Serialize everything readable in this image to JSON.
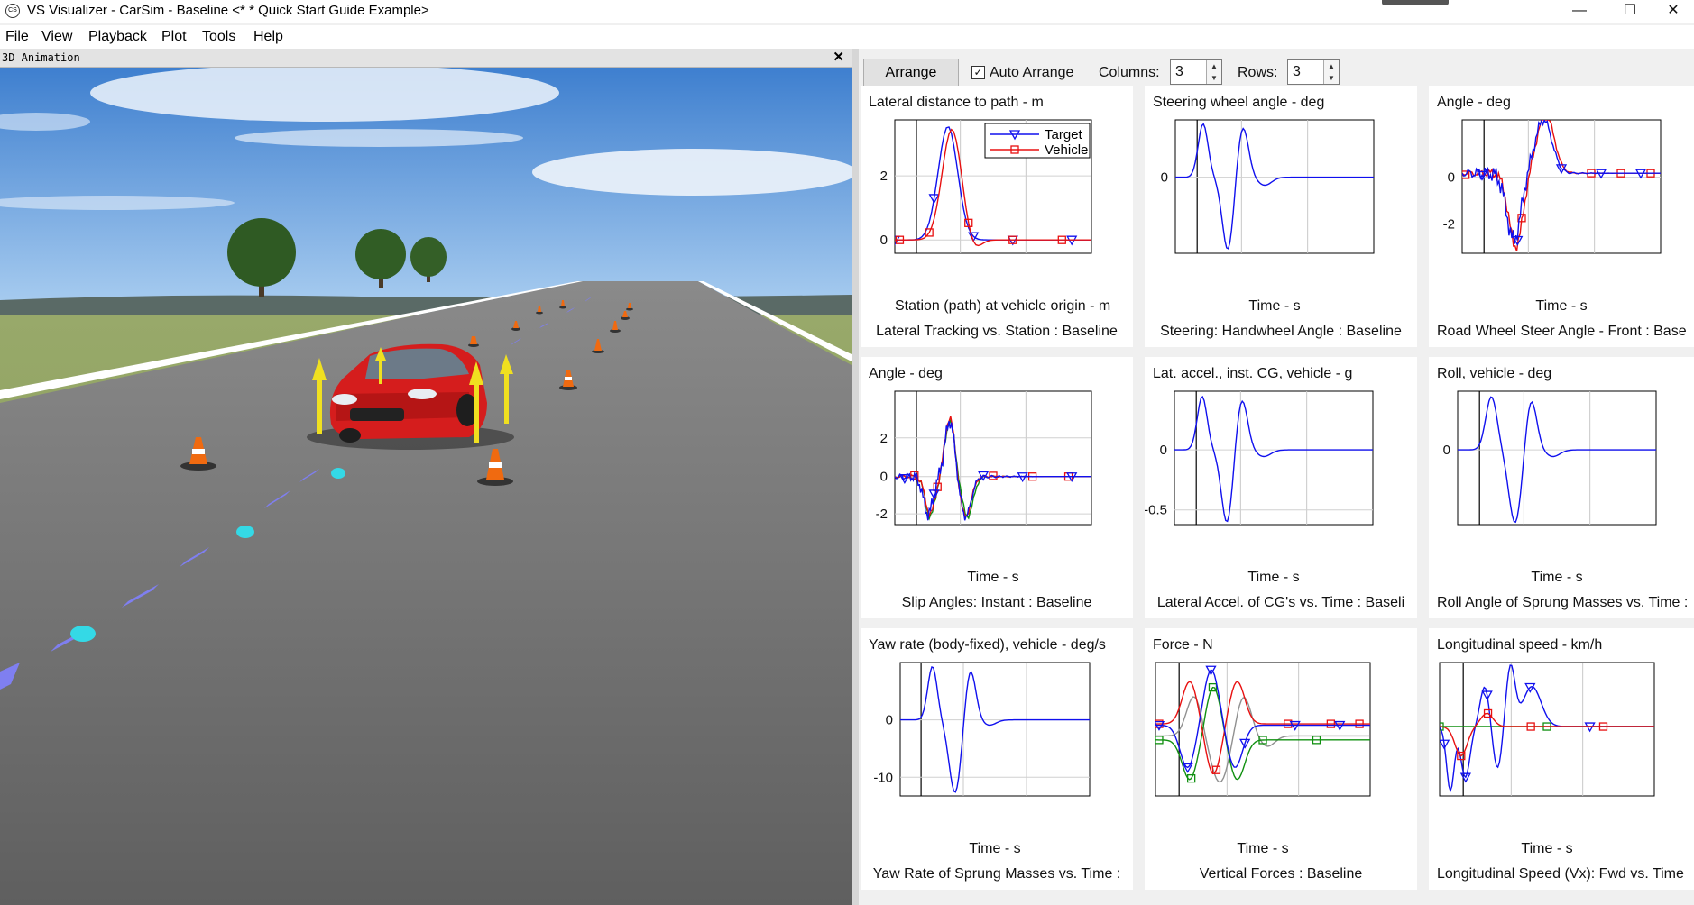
{
  "window": {
    "title": "VS Visualizer - CarSim - Baseline <* * Quick Start Guide Example>",
    "app_icon": "carsim-logo-icon",
    "app_icon_text": "CS",
    "controls": [
      "minimize-icon",
      "maximize-icon",
      "close-icon"
    ]
  },
  "menu": [
    "File",
    "View",
    "Playback",
    "Plot",
    "Tools",
    "Help"
  ],
  "animation": {
    "title": "3D Animation",
    "close_label": "✕",
    "colors": {
      "sky": "#5d9ad8",
      "grass": "#8ea25e",
      "road": "#6c6c6c",
      "car": "#d62020",
      "path_marker": "#7f7ff0"
    }
  },
  "toolbar": {
    "arrange_label": "Arrange",
    "auto_arrange_label": "Auto Arrange",
    "auto_arrange_checked": true,
    "columns_label": "Columns:",
    "columns_value": "3",
    "rows_label": "Rows:",
    "rows_value": "3"
  },
  "plots": [
    {
      "title": "Lateral distance to path - m",
      "xlabel": "Station (path) at vehicle origin - m",
      "caption": "Lateral Tracking vs. Station : Baseline",
      "yticks": [
        "2",
        "0"
      ],
      "legend": [
        "Target",
        "Vehicle"
      ]
    },
    {
      "title": "Steering wheel angle - deg",
      "xlabel": "Time - s",
      "caption": "Steering: Handwheel Angle : Baseline",
      "yticks": [
        "0"
      ]
    },
    {
      "title": "Angle - deg",
      "xlabel": "Time - s",
      "caption": "Road Wheel Steer Angle - Front : Base",
      "yticks": [
        "0",
        "-2"
      ]
    },
    {
      "title": "Angle - deg",
      "xlabel": "Time - s",
      "caption": "Slip Angles: Instant : Baseline",
      "yticks": [
        "2",
        "0",
        "-2"
      ]
    },
    {
      "title": "Lat. accel., inst. CG, vehicle - g",
      "xlabel": "Time - s",
      "caption": "Lateral Accel. of CG's vs. Time : Baseli",
      "yticks": [
        "0",
        "-0.5"
      ]
    },
    {
      "title": "Roll, vehicle - deg",
      "xlabel": "Time - s",
      "caption": "Roll Angle of Sprung Masses vs. Time :",
      "yticks": [
        "0"
      ]
    },
    {
      "title": "Yaw rate (body-fixed), vehicle - deg/s",
      "xlabel": "Time - s",
      "caption": "Yaw Rate of Sprung Masses vs. Time :",
      "yticks": [
        "0",
        "-10"
      ]
    },
    {
      "title": "Force - N",
      "xlabel": "Time - s",
      "caption": "Vertical Forces : Baseline",
      "yticks": []
    },
    {
      "title": "Longitudinal speed - km/h",
      "xlabel": "Time - s",
      "caption": "Longitudinal Speed (Vx): Fwd vs. Time",
      "yticks": []
    }
  ],
  "series_colors": {
    "target": "#1010ee",
    "vehicle": "#e81010",
    "green": "#109010",
    "gray": "#909090"
  }
}
